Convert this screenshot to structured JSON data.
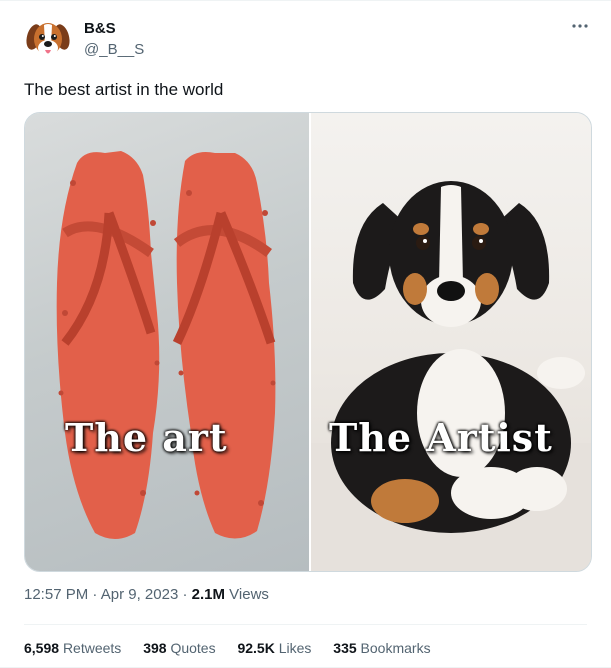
{
  "author": {
    "display_name": "B&S",
    "handle": "@_B__S",
    "avatar_icon": "dog-avatar-icon"
  },
  "more_icon": "more-dots-icon",
  "tweet": {
    "text": "The best artist in the world"
  },
  "media": {
    "left_caption": "The art",
    "right_caption": "The Artist",
    "left_image": "worn-red-flip-flops",
    "right_image": "tricolor-puppy"
  },
  "meta": {
    "time": "12:57 PM",
    "separator": "·",
    "date": "Apr 9, 2023",
    "views_count": "2.1M",
    "views_label": "Views"
  },
  "stats": [
    {
      "count": "6,598",
      "label": "Retweets"
    },
    {
      "count": "398",
      "label": "Quotes"
    },
    {
      "count": "92.5K",
      "label": "Likes"
    },
    {
      "count": "335",
      "label": "Bookmarks"
    }
  ],
  "colors": {
    "text_primary": "#0f1419",
    "text_secondary": "#536471",
    "border": "#cfd9de",
    "divider": "#eff3f4",
    "sandal_red": "#e2604a"
  }
}
